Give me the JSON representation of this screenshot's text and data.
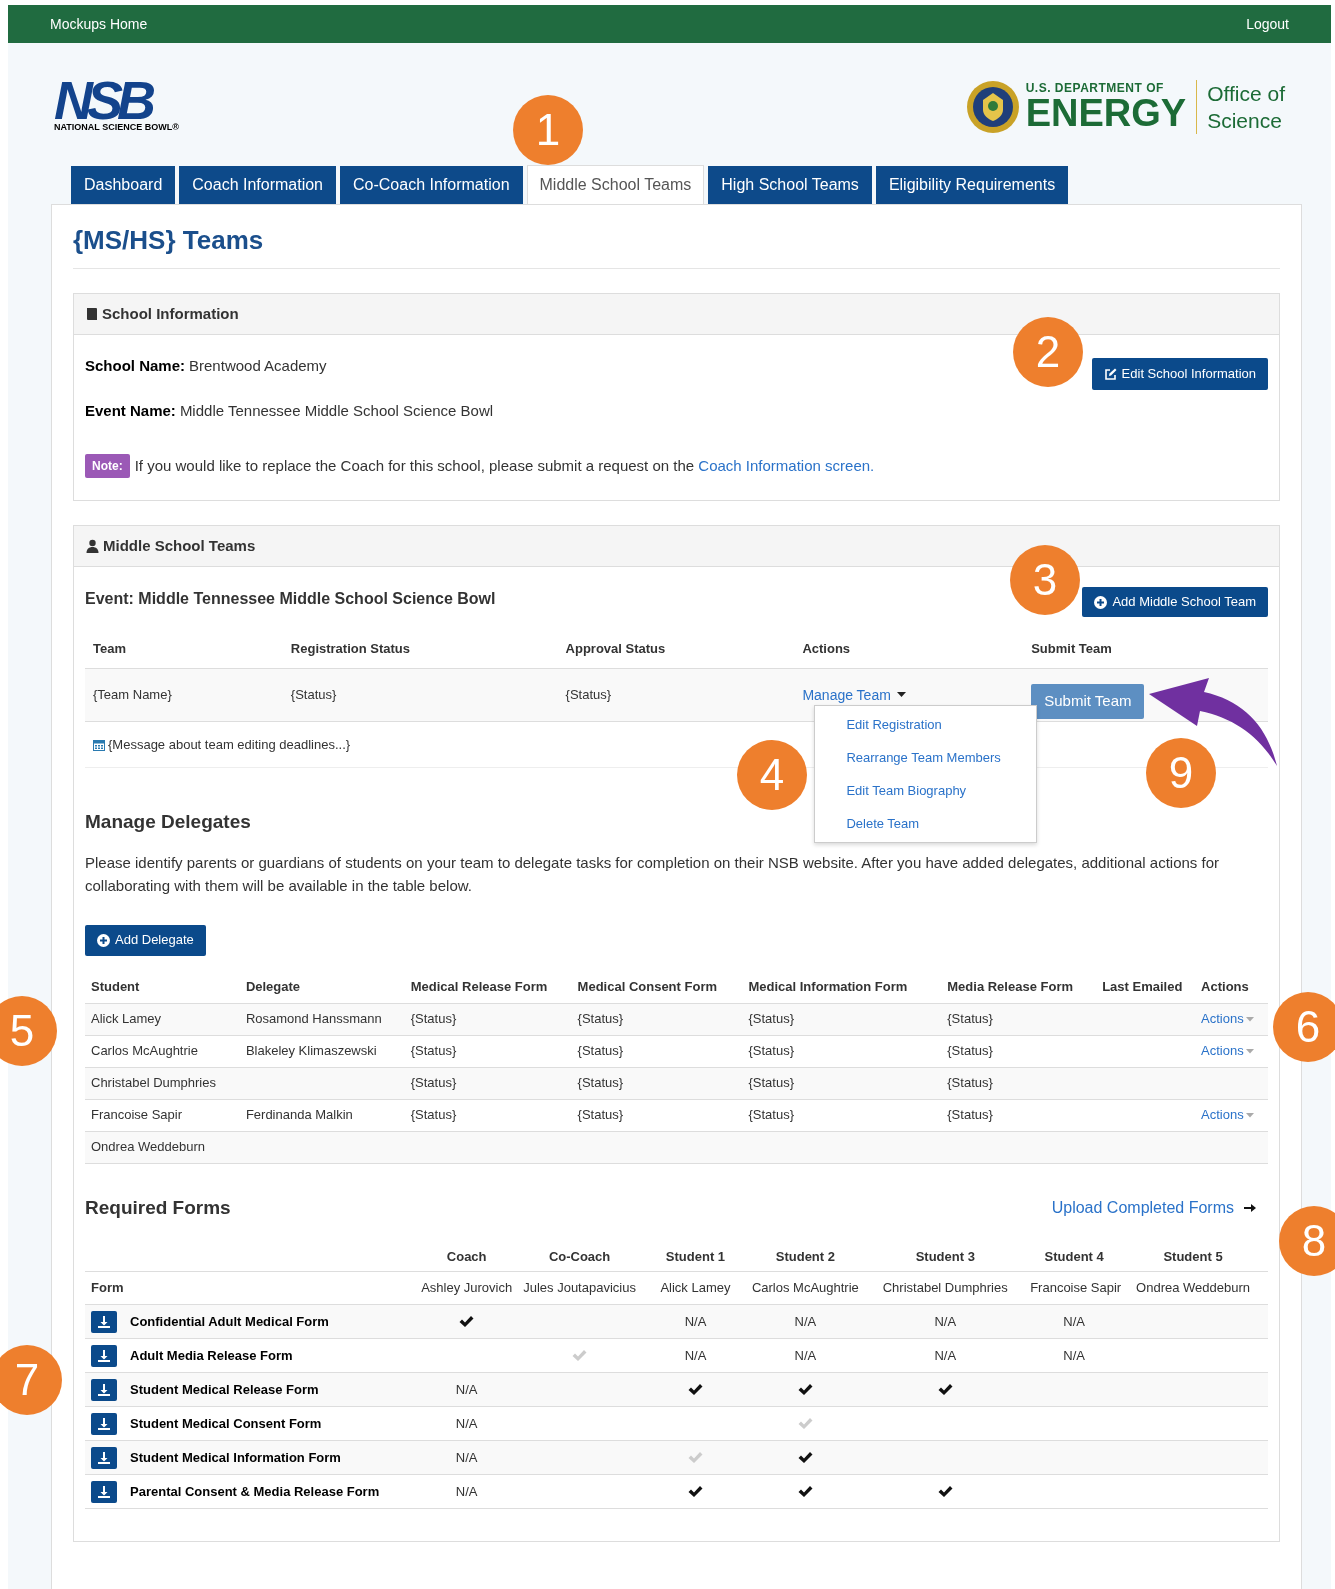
{
  "top_bar": {
    "home": "Mockups Home",
    "logout": "Logout"
  },
  "logos": {
    "nsb": {
      "mark": "NSB",
      "tagline": "NATIONAL SCIENCE BOWL®"
    },
    "doe": {
      "line1": "U.S. DEPARTMENT OF",
      "line2": "ENERGY",
      "office": [
        "Office of",
        "Science"
      ]
    }
  },
  "tabs": [
    {
      "label": "Dashboard",
      "selected": false
    },
    {
      "label": "Coach Information",
      "selected": false
    },
    {
      "label": "Co-Coach Information",
      "selected": false
    },
    {
      "label": "Middle School Teams",
      "selected": true
    },
    {
      "label": "High School Teams",
      "selected": false
    },
    {
      "label": "Eligibility Requirements",
      "selected": false
    }
  ],
  "page_title": "{MS/HS} Teams",
  "school_info": {
    "heading": "School Information",
    "edit_button": "Edit School Information",
    "fields": [
      {
        "label": "School Name:",
        "value": "Brentwood Academy"
      },
      {
        "label": "Event Name:",
        "value": "Middle Tennessee Middle School Science Bowl"
      }
    ],
    "note": {
      "badge": "Note:",
      "text": "If you would like to replace the Coach for this school, please submit a request on the",
      "link": "Coach Information screen."
    }
  },
  "teams": {
    "heading": "Middle School Teams",
    "event": "Event: Middle Tennessee Middle School Science Bowl",
    "add_button": "Add Middle School Team",
    "columns": [
      "Team",
      "Registration Status",
      "Approval Status",
      "Actions",
      "Submit Team"
    ],
    "rows": [
      {
        "team": "{Team Name}",
        "registration_status": "{Status}",
        "approval_status": "{Status}",
        "action": "Manage Team",
        "menu_expanded": true,
        "submit": "Submit Team",
        "submit_disabled": true
      }
    ],
    "menu": [
      "Edit Registration",
      "Rearrange Team Members",
      "Edit Team Biography",
      "Delete Team"
    ],
    "message": "{Message about team editing deadlines...}"
  },
  "delegates": {
    "heading": "Manage Delegates",
    "description": "Please identify parents or guardians of students on your team to delegate tasks for completion on their NSB website. After you have added delegates, additional actions for collaborating with them will be available in the table below.",
    "add_button": "Add Delegate",
    "columns": [
      "Student",
      "Delegate",
      "Medical Release Form",
      "Medical Consent Form",
      "Medical Information Form",
      "Media Release Form",
      "Last Emailed",
      "Actions"
    ],
    "rows": [
      {
        "student": "Alick Lamey",
        "delegate": "Rosamond Hanssmann",
        "forms": [
          "{Status}",
          "{Status}",
          "{Status}",
          "{Status}"
        ],
        "actions": "Actions"
      },
      {
        "student": "Carlos McAughtrie",
        "delegate": "Blakeley Klimaszewski",
        "forms": [
          "{Status}",
          "{Status}",
          "{Status}",
          "{Status}"
        ],
        "actions": "Actions"
      },
      {
        "student": "Christabel Dumphries",
        "forms": [
          "{Status}",
          "{Status}",
          "{Status}",
          "{Status}"
        ]
      },
      {
        "student": "Francoise Sapir",
        "delegate": "Ferdinanda Malkin",
        "forms": [
          "{Status}",
          "{Status}",
          "{Status}",
          "{Status}"
        ],
        "actions": "Actions"
      },
      {
        "student": "Ondrea Weddeburn"
      }
    ]
  },
  "forms": {
    "heading": "Required Forms",
    "upload_link": "Upload Completed Forms",
    "groups": [
      "Coach",
      "Co-Coach",
      "Student 1",
      "Student 2",
      "Student 3",
      "Student 4",
      "Student 5"
    ],
    "form_column": "Form",
    "people": [
      "Ashley Jurovich",
      "Jules Joutapavicius",
      "Alick Lamey",
      "Carlos McAughtrie",
      "Christabel Dumphries",
      "Francoise Sapir",
      "Ondrea Weddeburn"
    ],
    "rows": [
      {
        "name": "Confidential Adult Medical Form",
        "cells": [
          {
            "kind": "check"
          },
          null,
          {
            "kind": "text",
            "text": "N/A"
          },
          {
            "kind": "text",
            "text": "N/A"
          },
          {
            "kind": "text",
            "text": "N/A"
          },
          {
            "kind": "text",
            "text": "N/A"
          },
          null
        ]
      },
      {
        "name": "Adult Media Release Form",
        "cells": [
          null,
          {
            "kind": "pending"
          },
          {
            "kind": "text",
            "text": "N/A"
          },
          {
            "kind": "text",
            "text": "N/A"
          },
          {
            "kind": "text",
            "text": "N/A"
          },
          {
            "kind": "text",
            "text": "N/A"
          },
          null
        ]
      },
      {
        "name": "Student Medical Release Form",
        "cells": [
          {
            "kind": "text",
            "text": "N/A"
          },
          null,
          {
            "kind": "check"
          },
          {
            "kind": "check"
          },
          {
            "kind": "check"
          },
          null,
          null
        ]
      },
      {
        "name": "Student Medical Consent Form",
        "cells": [
          {
            "kind": "text",
            "text": "N/A"
          },
          null,
          null,
          {
            "kind": "pending"
          },
          null,
          null,
          null
        ]
      },
      {
        "name": "Student Medical Information Form",
        "cells": [
          {
            "kind": "text",
            "text": "N/A"
          },
          null,
          {
            "kind": "pending"
          },
          {
            "kind": "check"
          },
          null,
          null,
          null
        ]
      },
      {
        "name": "Parental Consent & Media Release Form",
        "cells": [
          {
            "kind": "text",
            "text": "N/A"
          },
          null,
          {
            "kind": "check"
          },
          {
            "kind": "check"
          },
          {
            "kind": "check"
          },
          null,
          null
        ]
      }
    ]
  },
  "annotations": [
    "1",
    "2",
    "3",
    "4",
    "5",
    "6",
    "7",
    "8",
    "9"
  ]
}
